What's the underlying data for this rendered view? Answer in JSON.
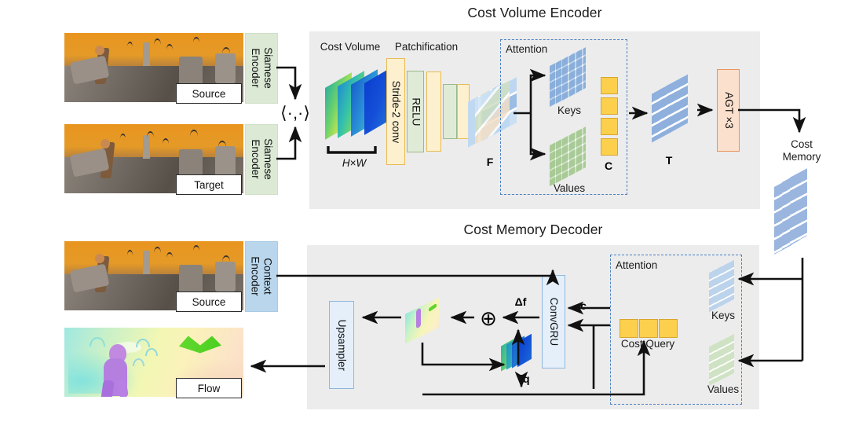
{
  "figure": {
    "type": "architecture-diagram",
    "top_section_title": "Cost Volume Encoder",
    "bottom_section_title": "Cost Memory Decoder"
  },
  "encoder_inputs": {
    "source_caption": "Source",
    "target_caption": "Target",
    "siamese_encoder_label": "Siamese Encoder",
    "correlation_symbol": "⟨·,·⟩"
  },
  "cost_volume_encoder": {
    "cost_volume_label": "Cost Volume",
    "hw_label": "H×W",
    "patchification_label": "Patchification",
    "stride_conv_label": "Stride-2 conv",
    "relu_label": "RELU",
    "feature_symbol": "F",
    "attention_label": "Attention",
    "keys_label": "Keys",
    "values_label": "Values",
    "c_symbol": "C",
    "t_symbol": "T",
    "agt_label": "AGT ×3",
    "cost_memory_label_line1": "Cost",
    "cost_memory_label_line2": "Memory"
  },
  "cost_memory_decoder": {
    "source_caption": "Source",
    "flow_caption": "Flow",
    "context_encoder_label": "Context Encoder",
    "upsampler_label": "Upsampler",
    "convgru_label": "ConvGRU",
    "delta_f_symbol": "Δf",
    "c_symbol": "c",
    "q_symbol": "q",
    "plus_symbol": "⊕",
    "attention_label": "Attention",
    "cost_query_label": "Cost Query",
    "keys_label": "Keys",
    "values_label": "Values"
  },
  "colors": {
    "panel_bg": "#ececec",
    "siamese_encoder": "#dbe9d5",
    "context_encoder": "#b9d6ec",
    "agt_block": "#fbe0cd",
    "convgru_block": "#e4effa",
    "yellow_bar": "#fdf0cf",
    "green_bar": "#dfebd7",
    "cost_query_square": "#fccf4d",
    "attention_dash_border": "#4a7fc1",
    "keys_stack": "#bcd3ec",
    "values_stack": "#cfe3c4",
    "memory_stack": "#9ab6de"
  }
}
